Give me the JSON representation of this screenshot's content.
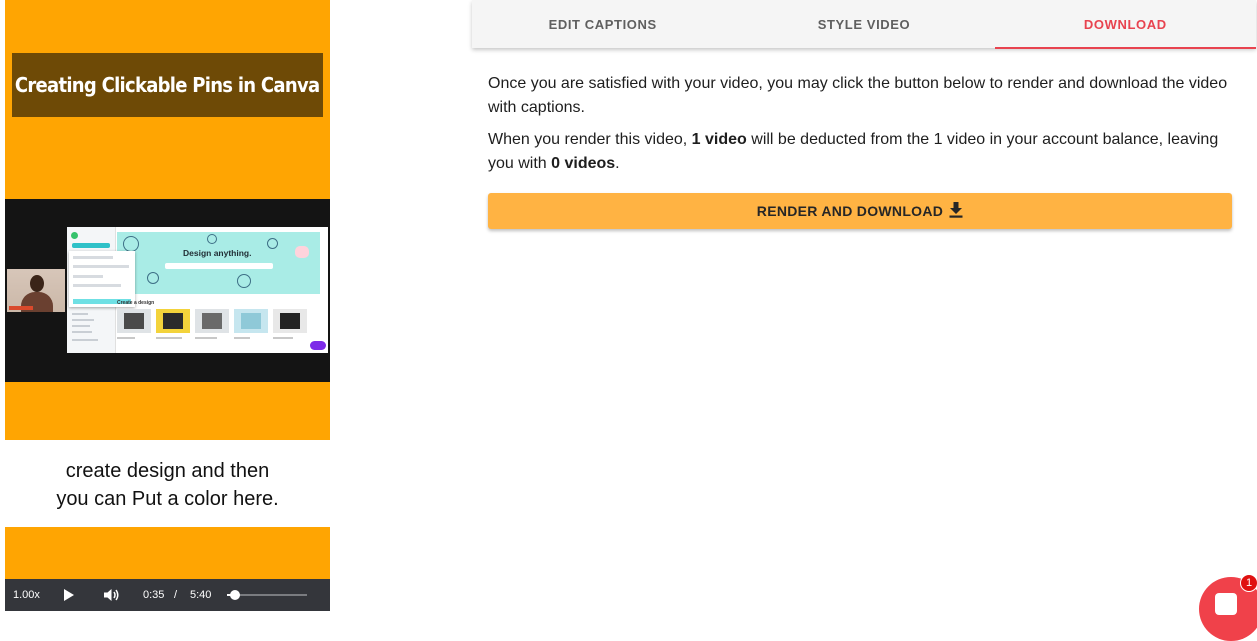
{
  "video": {
    "title": "Creating Clickable Pins in Canva",
    "screenshot_heading": "Design anything.",
    "screenshot_subheading": "Create a design",
    "caption_line1": "create design and then",
    "caption_line2": "you can Put a color here.",
    "controls": {
      "speed": "1.00x",
      "current_time": "0:35",
      "separator": "/",
      "duration": "5:40",
      "progress": 0.103
    },
    "colors": {
      "frame": "#ffa502",
      "title_box": "#6e4a06",
      "controls_bg": "#34363b"
    }
  },
  "tabs": [
    {
      "label": "EDIT CAPTIONS",
      "active": false
    },
    {
      "label": "STYLE VIDEO",
      "active": false
    },
    {
      "label": "DOWNLOAD",
      "active": true
    }
  ],
  "download": {
    "intro": "Once you are satisfied with your video, you may click the button below to render and download the video with captions.",
    "deduct_prefix": "When you render this video, ",
    "deduct_amount": "1 video",
    "deduct_middle": " will be deducted from the 1 video in your account balance, leaving you with ",
    "remaining": "0 videos",
    "deduct_suffix": ".",
    "button_label": "RENDER AND DOWNLOAD",
    "button_icon": "download-icon"
  },
  "chat": {
    "badge_count": "1",
    "icon": "chat-icon",
    "color": "#f0414a"
  },
  "accent_color": "#e8434f",
  "button_color": "#ffb343"
}
